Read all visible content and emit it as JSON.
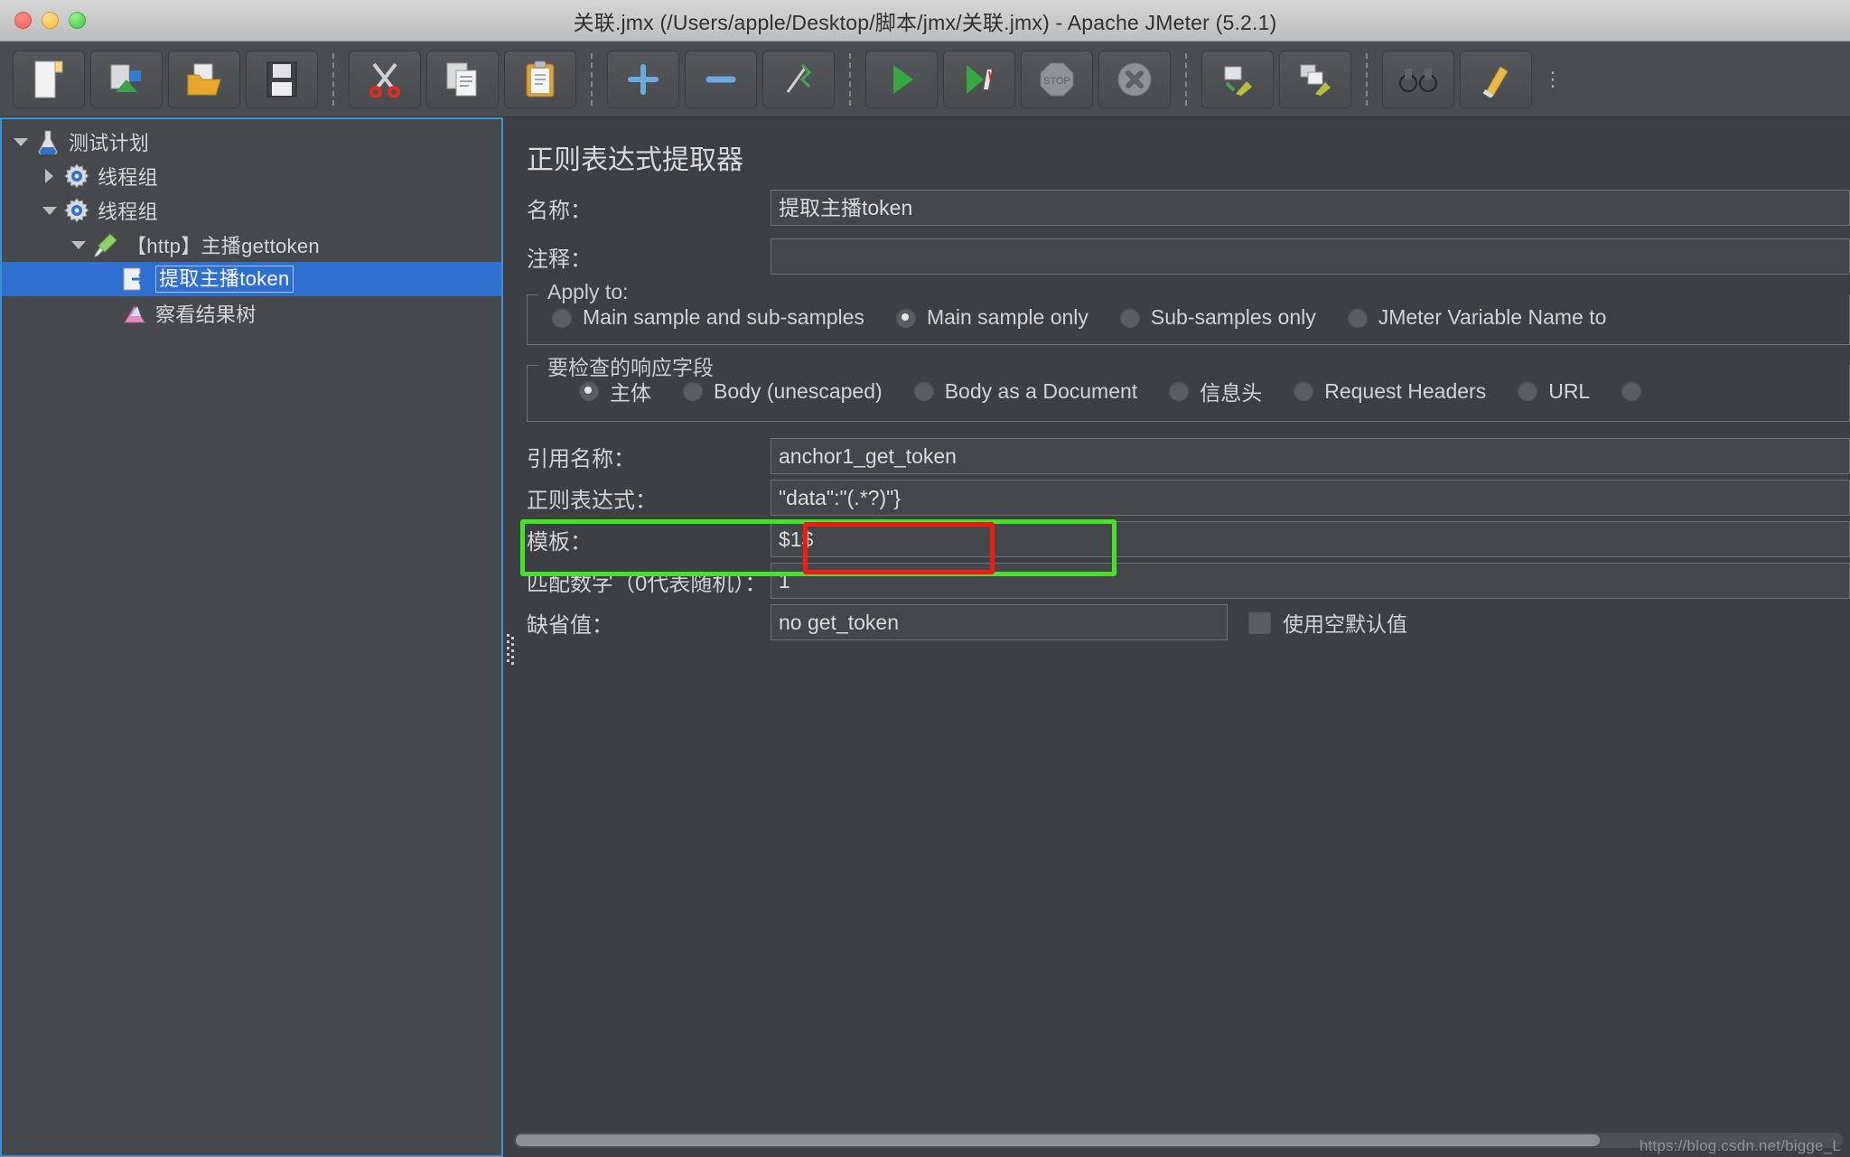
{
  "window": {
    "title": "关联.jmx (/Users/apple/Desktop/脚本/jmx/关联.jmx) - Apache JMeter (5.2.1)",
    "traffic_lights": [
      "close-button",
      "minimize-button",
      "zoom-button"
    ]
  },
  "toolbar": {
    "buttons": [
      {
        "name": "new-button",
        "icon": "new-document-icon"
      },
      {
        "name": "templates-button",
        "icon": "templates-icon"
      },
      {
        "name": "open-button",
        "icon": "open-folder-icon"
      },
      {
        "name": "save-button",
        "icon": "save-disk-icon"
      },
      {
        "name": "cut-button",
        "icon": "scissors-icon"
      },
      {
        "name": "copy-button",
        "icon": "copy-pages-icon"
      },
      {
        "name": "paste-button",
        "icon": "clipboard-icon"
      },
      {
        "name": "expand-all-button",
        "icon": "plus-icon"
      },
      {
        "name": "collapse-all-button",
        "icon": "minus-icon"
      },
      {
        "name": "toggle-button",
        "icon": "toggle-lightning-icon"
      },
      {
        "name": "start-button",
        "icon": "green-play-icon"
      },
      {
        "name": "start-no-pauses-button",
        "icon": "green-play-no-pause-icon"
      },
      {
        "name": "stop-button",
        "icon": "stop-octagon-icon"
      },
      {
        "name": "shutdown-button",
        "icon": "shutdown-x-icon"
      },
      {
        "name": "clear-button",
        "icon": "broom-clear-icon"
      },
      {
        "name": "clear-all-button",
        "icon": "broom-clear-all-icon"
      },
      {
        "name": "search-button",
        "icon": "binoculars-search-icon"
      },
      {
        "name": "reset-search-button",
        "icon": "brush-reset-icon"
      }
    ]
  },
  "tree": {
    "items": [
      {
        "label": "测试计划",
        "icon": "test-plan-flask-icon",
        "twisty": "down",
        "indent": 1,
        "selected": false
      },
      {
        "label": "线程组",
        "icon": "thread-group-gear-icon",
        "twisty": "right",
        "indent": 2,
        "selected": false
      },
      {
        "label": "线程组",
        "icon": "thread-group-gear-icon",
        "twisty": "down",
        "indent": 2,
        "selected": false
      },
      {
        "label": "【http】主播gettoken",
        "icon": "http-sampler-pipette-icon",
        "twisty": "down",
        "indent": 3,
        "selected": false
      },
      {
        "label": "提取主播token",
        "icon": "regex-extractor-icon",
        "twisty": "none",
        "indent": 4,
        "selected": true
      },
      {
        "label": "察看结果树",
        "icon": "view-results-tree-icon",
        "twisty": "none",
        "indent": 4,
        "selected": false
      }
    ]
  },
  "panel": {
    "title": "正则表达式提取器",
    "name_label": "名称：",
    "name_value": "提取主播token",
    "comment_label": "注释：",
    "comment_value": "",
    "apply_to": {
      "legend": "Apply to:",
      "options": [
        {
          "label": "Main sample and sub-samples",
          "selected": false
        },
        {
          "label": "Main sample only",
          "selected": true
        },
        {
          "label": "Sub-samples only",
          "selected": false
        },
        {
          "label": "JMeter Variable Name to",
          "selected": false
        }
      ]
    },
    "field_to_check": {
      "legend": "要检查的响应字段",
      "options": [
        {
          "label": "主体",
          "selected": true
        },
        {
          "label": "Body (unescaped)",
          "selected": false
        },
        {
          "label": "Body as a Document",
          "selected": false
        },
        {
          "label": "信息头",
          "selected": false
        },
        {
          "label": "Request Headers",
          "selected": false
        },
        {
          "label": "URL",
          "selected": false
        }
      ]
    },
    "fields": [
      {
        "label": "引用名称：",
        "value": "anchor1_get_token",
        "name": "reference-name"
      },
      {
        "label": "正则表达式：",
        "value": "\"data\":\"(.*?)\"}",
        "name": "regular-expression"
      },
      {
        "label": "模板：",
        "value": "$1$",
        "name": "template"
      },
      {
        "label": "匹配数字（0代表随机）：",
        "value": "1",
        "name": "match-number"
      },
      {
        "label": "缺省值：",
        "value": "no get_token",
        "name": "default-value"
      }
    ],
    "use_empty_default_label": "使用空默认值",
    "use_empty_default_checked": false
  },
  "footer": {
    "watermark": "https://blog.csdn.net/bigge_L"
  },
  "colors": {
    "selection_blue": "#2f6fd0",
    "panel_border_blue": "#3d8fd8",
    "highlight_green": "#44e326",
    "highlight_red": "#f31a12",
    "background": "#3c4043"
  }
}
